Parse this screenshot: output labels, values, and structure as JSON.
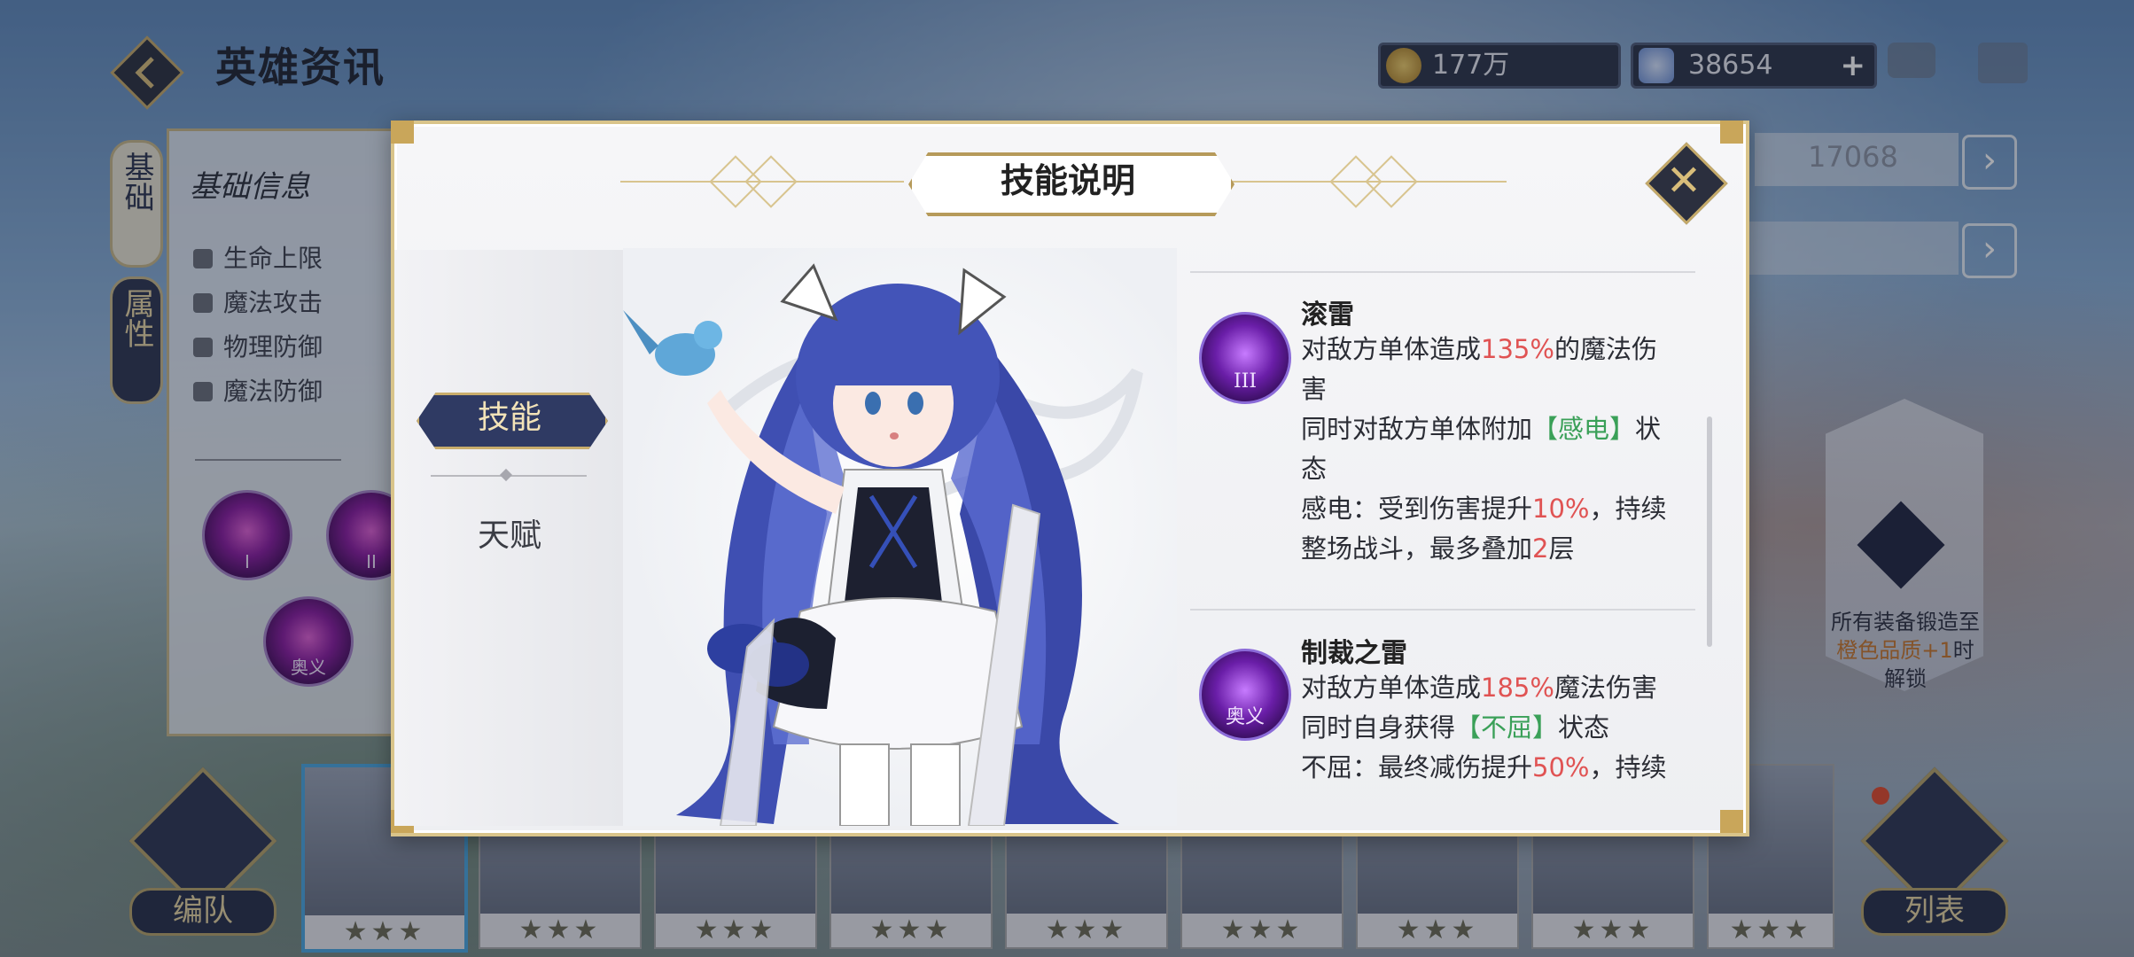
{
  "header": {
    "title": "英雄资讯",
    "gold": "177万",
    "gems": "38654",
    "gem_plus": "+"
  },
  "left_panel": {
    "tabs": [
      "基础",
      "属性"
    ],
    "section_title": "基础信息",
    "stats": [
      "生命上限",
      "魔法攻击",
      "物理防御",
      "魔法防御"
    ],
    "orbs": [
      "I",
      "II",
      "奥义"
    ]
  },
  "right_side": {
    "rank_value": "17068",
    "lock_text_1": "所有装备锻造至",
    "lock_text_2": "橙色品质+1",
    "lock_text_3": "时解锁"
  },
  "bottom": {
    "team_label": "编队",
    "list_label": "列表",
    "roster_stars": [
      "★★★",
      "★★★",
      "★★★",
      "★★★",
      "★★★",
      "★★★",
      "★★★",
      "★★★",
      "★★★",
      "★★★"
    ]
  },
  "dialog": {
    "title": "技能说明",
    "close_icon": "close-icon",
    "tabs": {
      "skill": "技能",
      "talent": "天赋"
    },
    "skills": [
      {
        "name": "滚雷",
        "icon_numeral": "III",
        "lines": [
          [
            "对敌方单体造成",
            "135%",
            "的魔法伤"
          ],
          [
            "害"
          ],
          [
            "同时对敌方单体附加",
            "【感电】",
            "状"
          ],
          [
            "态"
          ],
          [
            "感电：受到伤害提升",
            "10%",
            "，持续"
          ],
          [
            "整场战斗，最多叠加",
            "2",
            "层"
          ]
        ]
      },
      {
        "name": "制裁之雷",
        "icon_numeral": "奥义",
        "lines": [
          [
            "对敌方单体造成",
            "185%",
            "魔法伤害"
          ],
          [
            "同时自身获得",
            "【不屈】",
            "状态"
          ],
          [
            "不屈：最终减伤提升",
            "50%",
            "，持续"
          ]
        ]
      }
    ]
  },
  "colors": {
    "accent_gold": "#c9ad6c",
    "navy": "#2f3a63",
    "highlight_red": "#e05353",
    "highlight_green": "#3aa058"
  }
}
